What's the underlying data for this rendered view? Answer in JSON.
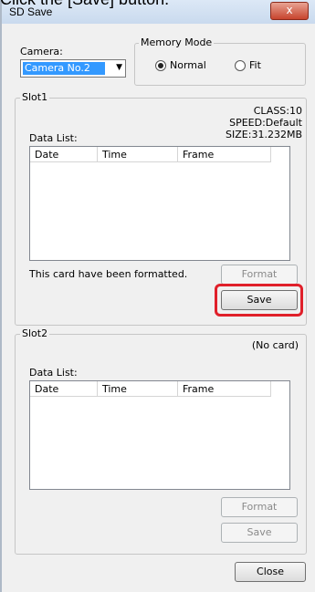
{
  "caption": "Click the [Save] button.",
  "window": {
    "title": "SD Save",
    "close_glyph": "x"
  },
  "camera": {
    "label": "Camera:",
    "selected": "Camera No.2"
  },
  "memory_mode": {
    "label": "Memory Mode",
    "options": [
      {
        "label": "Normal",
        "checked": true
      },
      {
        "label": "Fit",
        "checked": false
      }
    ]
  },
  "slot1": {
    "title": "Slot1",
    "card_class": "CLASS:10",
    "card_speed": "SPEED:Default",
    "card_size": "SIZE:31.232MB",
    "data_list_label": "Data List:",
    "columns": [
      "Date",
      "Time",
      "Frame"
    ],
    "status": "This card have been formatted.",
    "format_label": "Format",
    "save_label": "Save"
  },
  "slot2": {
    "title": "Slot2",
    "card_status": "(No card)",
    "data_list_label": "Data List:",
    "columns": [
      "Date",
      "Time",
      "Frame"
    ],
    "format_label": "Format",
    "save_label": "Save"
  },
  "footer": {
    "close_label": "Close"
  },
  "colors": {
    "highlight": "#e0202a",
    "selection": "#3399ff"
  }
}
